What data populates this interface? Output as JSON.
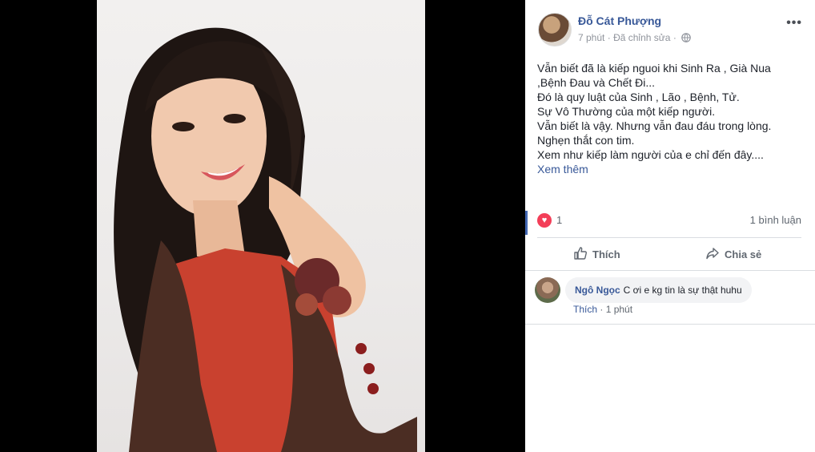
{
  "post": {
    "author": "Đỗ Cát Phượng",
    "time": "7 phút",
    "edited": "Đã chỉnh sửa",
    "privacy_icon": "globe-icon",
    "more_label": "•••",
    "lines": [
      "Vẫn biết đã là kiếp nguoi khi Sinh Ra , Già Nua",
      ",Bệnh Đau và Chết Đi...",
      "Đó là quy luật của Sinh , Lão , Bệnh, Tử.",
      "Sự Vô Thường của một kiếp người.",
      "Vẫn biết là vậy. Nhưng vẫn đau đáu trong lòng.",
      "Nghẹn thắt con tim.",
      "Xem như kiếp làm người của e chỉ đến đây...."
    ],
    "see_more": "Xem thêm"
  },
  "stats": {
    "reaction_icon": "heart-icon",
    "reaction_count": "1",
    "comment_count": "1 bình luận"
  },
  "actions": {
    "like_label": "Thích",
    "share_label": "Chia sẻ"
  },
  "comment": {
    "name": "Ngô Ngọc",
    "text": "C ơi e kg tin là sự thật huhu",
    "like_label": "Thích",
    "separator": "·",
    "time": "1 phút"
  },
  "colors": {
    "link": "#385898",
    "heart": "#f33e58",
    "background": "#000000"
  }
}
